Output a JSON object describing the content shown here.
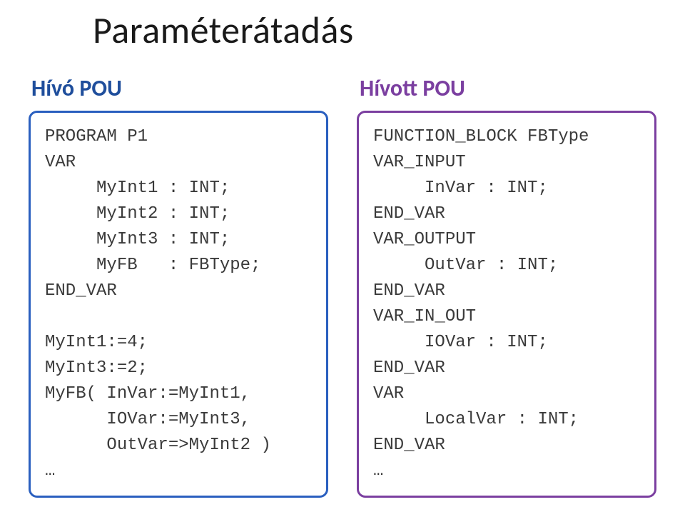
{
  "title": "Paraméterátadás",
  "left": {
    "heading": "Hívó POU",
    "code": "PROGRAM P1\nVAR\n     MyInt1 : INT;\n     MyInt2 : INT;\n     MyInt3 : INT;\n     MyFB   : FBType;\nEND_VAR\n\nMyInt1:=4;\nMyInt3:=2;\nMyFB( InVar:=MyInt1,\n      IOVar:=MyInt3,\n      OutVar=>MyInt2 )\n…"
  },
  "right": {
    "heading": "Hívott POU",
    "code": "FUNCTION_BLOCK FBType\nVAR_INPUT\n     InVar : INT;\nEND_VAR\nVAR_OUTPUT\n     OutVar : INT;\nEND_VAR\nVAR_IN_OUT\n     IOVar : INT;\nEND_VAR\nVAR\n     LocalVar : INT;\nEND_VAR\n…"
  }
}
